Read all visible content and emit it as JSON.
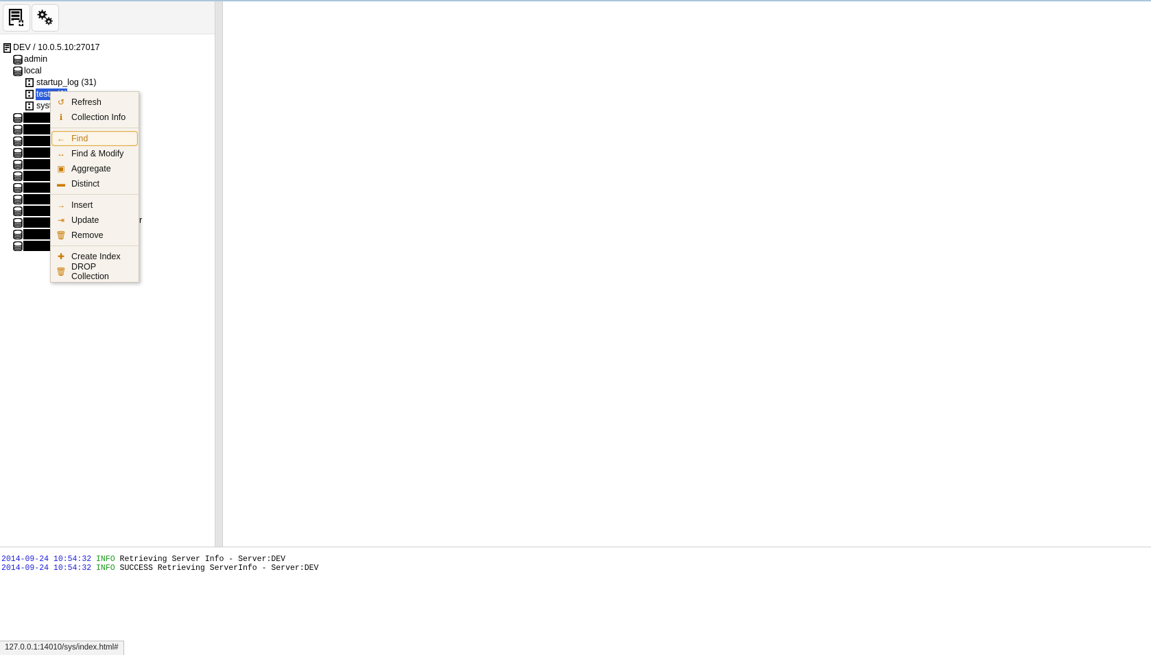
{
  "window": {
    "status_bar_text": "127.0.0.1:14010/sys/index.html#"
  },
  "toolbar": {
    "buttons": [
      {
        "name": "add-server-button",
        "icon": "server-add-icon",
        "tooltip": "Add Server"
      },
      {
        "name": "settings-button",
        "icon": "gears-icon",
        "tooltip": "Settings"
      }
    ]
  },
  "tree": {
    "server": {
      "label": "DEV / 10.0.5.10:27017",
      "icon": "server-icon"
    },
    "databases": [
      {
        "label": "admin",
        "icon": "database-icon",
        "redacted": false,
        "collections": []
      },
      {
        "label": "local",
        "icon": "database-icon",
        "redacted": false,
        "collections": [
          {
            "label": "startup_log (31)",
            "icon": "collection-icon",
            "selected": false
          },
          {
            "label": "tests (0)",
            "icon": "collection-icon",
            "selected": true
          },
          {
            "label": "system.indexes (3)",
            "icon": "collection-icon",
            "selected": false
          }
        ]
      },
      {
        "label": "",
        "icon": "database-icon",
        "redacted": true,
        "redacted_width": 74,
        "collections": []
      },
      {
        "label": "",
        "icon": "database-icon",
        "redacted": true,
        "redacted_width": 74,
        "collections": []
      },
      {
        "label": "",
        "icon": "database-icon",
        "redacted": true,
        "redacted_width": 74,
        "collections": []
      },
      {
        "label": "",
        "icon": "database-icon",
        "redacted": true,
        "redacted_width": 74,
        "collections": []
      },
      {
        "label": "",
        "icon": "database-icon",
        "redacted": true,
        "redacted_width": 74,
        "collections": []
      },
      {
        "label": "",
        "icon": "database-icon",
        "redacted": true,
        "redacted_width": 74,
        "collections": []
      },
      {
        "label": "",
        "icon": "database-icon",
        "redacted": true,
        "redacted_width": 74,
        "collections": []
      },
      {
        "label": "",
        "icon": "database-icon",
        "redacted": true,
        "redacted_width": 74,
        "collections": []
      },
      {
        "label": "",
        "icon": "database-icon",
        "redacted": true,
        "redacted_width": 74,
        "collections": []
      },
      {
        "label": "",
        "icon": "database-icon",
        "redacted": true,
        "redacted_width": 74,
        "collections": []
      },
      {
        "label": "",
        "icon": "database-icon",
        "redacted": true,
        "redacted_width": 74,
        "collections": []
      },
      {
        "label": "",
        "icon": "database-icon",
        "redacted": true,
        "redacted_width": 74,
        "collections": []
      }
    ]
  },
  "context_menu": {
    "visible": true,
    "stray_char": "r",
    "groups": [
      {
        "items": [
          {
            "label": "Refresh",
            "icon": "refresh-icon",
            "glyph": "↺",
            "active": false
          },
          {
            "label": "Collection Info",
            "icon": "info-icon",
            "glyph": "ℹ",
            "active": false
          }
        ]
      },
      {
        "items": [
          {
            "label": "Find",
            "icon": "arrow-left-icon",
            "glyph": "←",
            "active": true
          },
          {
            "label": "Find & Modify",
            "icon": "arrows-horizontal-icon",
            "glyph": "↔",
            "active": false
          },
          {
            "label": "Aggregate",
            "icon": "aggregate-icon",
            "glyph": "▣",
            "active": false
          },
          {
            "label": "Distinct",
            "icon": "distinct-icon",
            "glyph": "▬",
            "active": false
          }
        ]
      },
      {
        "items": [
          {
            "label": "Insert",
            "icon": "arrow-right-icon",
            "glyph": "→",
            "active": false
          },
          {
            "label": "Update",
            "icon": "arrow-to-bar-icon",
            "glyph": "⇥",
            "active": false
          },
          {
            "label": "Remove",
            "icon": "trash-icon",
            "glyph": "🗑",
            "active": false
          }
        ]
      },
      {
        "items": [
          {
            "label": "Create Index",
            "icon": "plus-icon",
            "glyph": "✚",
            "active": false
          },
          {
            "label": "DROP Collection",
            "icon": "trash-icon",
            "glyph": "🗑",
            "active": false
          }
        ]
      }
    ]
  },
  "log": {
    "lines": [
      {
        "timestamp": "2014-09-24 10:54:32",
        "level": "INFO",
        "message": "Retrieving Server Info - Server:DEV"
      },
      {
        "timestamp": "2014-09-24 10:54:32",
        "level": "INFO",
        "message": "SUCCESS Retrieving ServerInfo - Server:DEV"
      }
    ]
  },
  "colors": {
    "selection_blue": "#2b5ddb",
    "menu_accent_orange": "#cc7a00",
    "menu_bg": "#f7f3ec",
    "log_timestamp": "#1c1cdb",
    "log_level": "#1a9a1a"
  }
}
